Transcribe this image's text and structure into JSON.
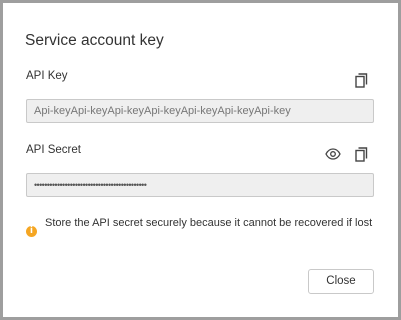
{
  "dialog": {
    "title": "Service account key",
    "api_key": {
      "label": "API Key",
      "value": "Api-keyApi-keyApi-keyApi-keyApi-keyApi-keyApi-key"
    },
    "api_secret": {
      "label": "API Secret",
      "value": "••••••••••••••••••••••••••••••••••••••••••••"
    },
    "warning": {
      "icon_glyph": "i",
      "text": "Store the API secret securely because it cannot be recovered if lost"
    },
    "close_label": "Close"
  },
  "colors": {
    "warning": "#f5a623",
    "field_background": "#efefef",
    "field_border": "#c9c9c9",
    "icon": "#444444"
  },
  "icons": [
    "copy-icon",
    "eye-icon",
    "info-icon"
  ]
}
